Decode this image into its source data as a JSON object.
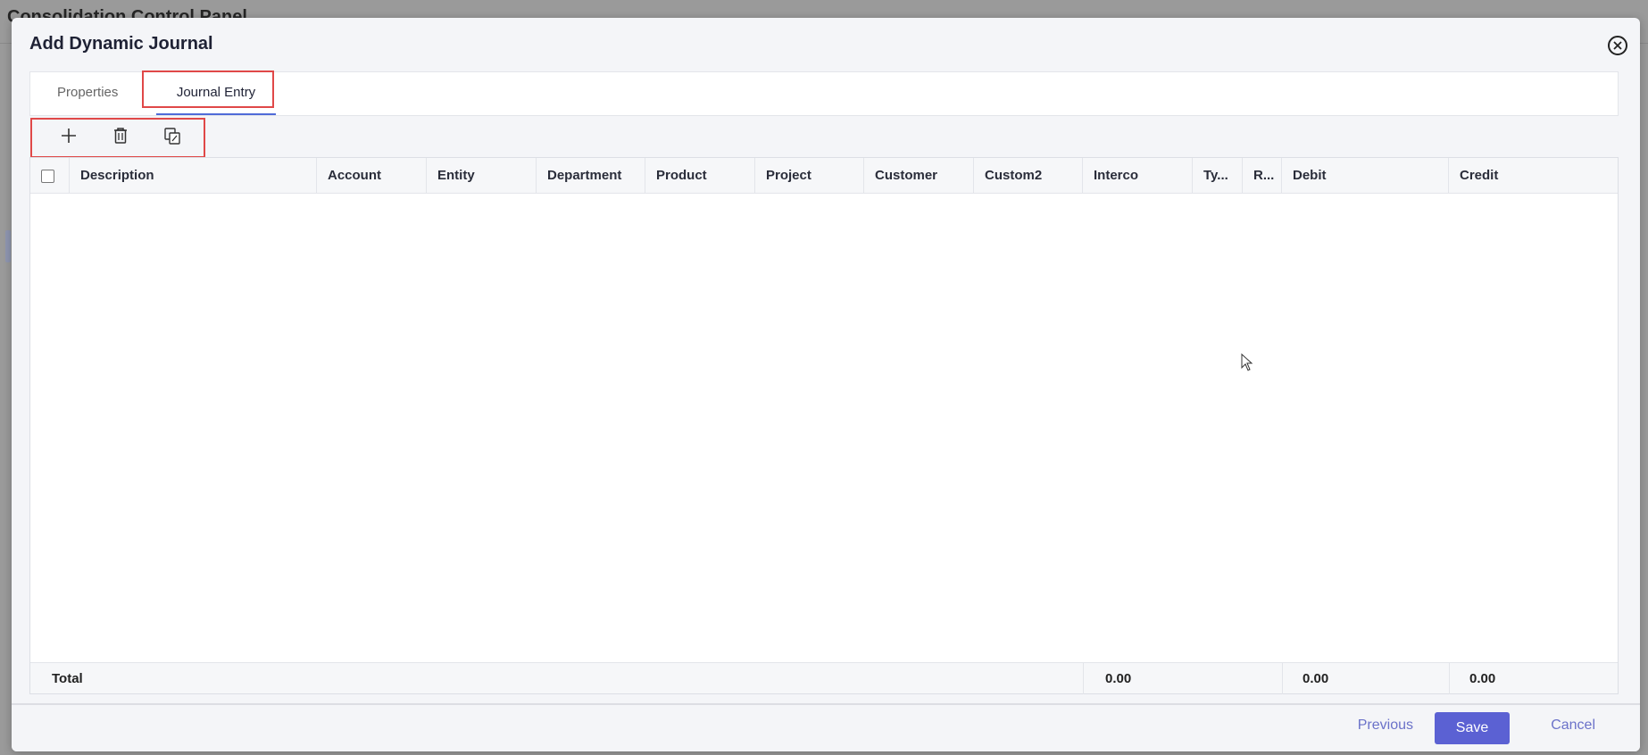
{
  "background": {
    "title": "Consolidation Control Panel"
  },
  "modal": {
    "title": "Add Dynamic Journal",
    "tabs": [
      {
        "label": "Properties"
      },
      {
        "label": "Journal Entry"
      }
    ],
    "toolbar": {
      "add_icon": "plus-icon",
      "delete_icon": "trash-icon",
      "copy_icon": "copy-icon"
    },
    "grid": {
      "columns": [
        "Description",
        "Account",
        "Entity",
        "Department",
        "Product",
        "Project",
        "Customer",
        "Custom2",
        "Interco",
        "Ty...",
        "R...",
        "Debit",
        "Credit"
      ],
      "footer": {
        "label": "Total",
        "interco_total": "0.00",
        "debit_total": "0.00",
        "credit_total": "0.00"
      }
    },
    "footer": {
      "previous_label": "Previous",
      "save_label": "Save",
      "cancel_label": "Cancel"
    }
  },
  "colors": {
    "accent": "#5b61d3",
    "highlight": "#e04848",
    "tab_underline": "#4f6bd8"
  }
}
